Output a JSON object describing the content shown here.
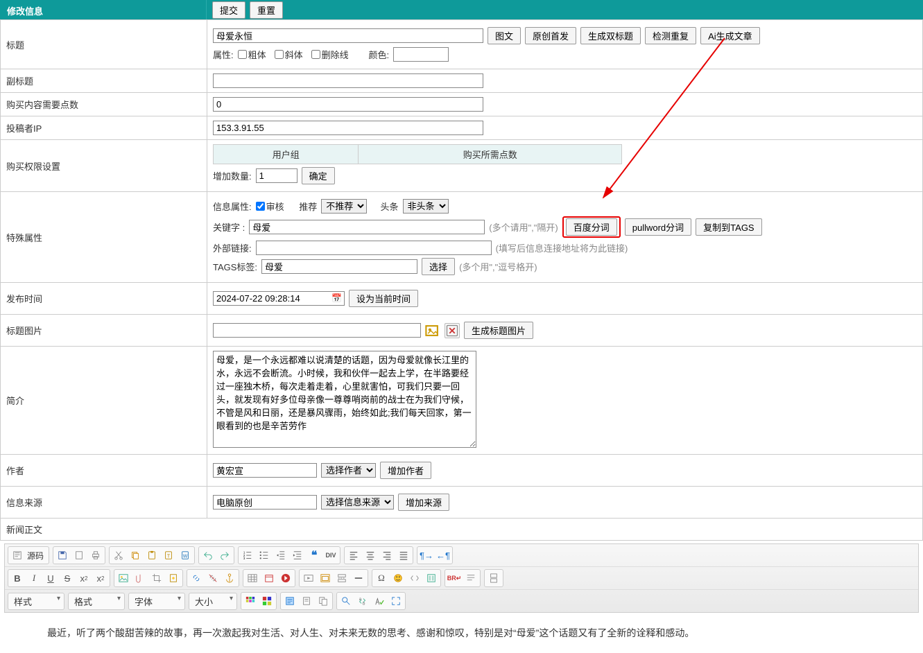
{
  "header": {
    "title": "修改信息",
    "submit": "提交",
    "reset": "重置"
  },
  "title_row": {
    "label": "标题",
    "value": "母爱永恒",
    "btn_media": "图文",
    "btn_original": "原创首发",
    "btn_dualtitle": "生成双标题",
    "btn_dup": "检测重复",
    "btn_ai": "Ai生成文章",
    "attr_label": "属性:",
    "chk_bold": "粗体",
    "chk_italic": "斜体",
    "chk_strike": "删除线",
    "color_label": "颜色:"
  },
  "subtitle": {
    "label": "副标题",
    "value": ""
  },
  "points": {
    "label": "购买内容需要点数",
    "value": "0"
  },
  "ip": {
    "label": "投稿者IP",
    "value": "153.3.91.55"
  },
  "perm": {
    "label": "购买权限设置",
    "col1": "用户组",
    "col2": "购买所需点数",
    "add_label": "增加数量:",
    "add_value": "1",
    "confirm": "确定"
  },
  "special": {
    "label": "特殊属性",
    "info_attr": "信息属性:",
    "audit": "审核",
    "recommend_label": "推荐",
    "recommend_value": "不推荐",
    "headline_label": "头条",
    "headline_value": "非头条",
    "kw_label": "关键字   :",
    "kw_value": "母爱",
    "kw_hint": "(多个请用\",\"隔开)",
    "btn_baidu": "百度分词",
    "btn_pullword": "pullword分词",
    "btn_copytags": "复制到TAGS",
    "ext_label": "外部链接:",
    "ext_value": "",
    "ext_hint": "(填写后信息连接地址将为此链接)",
    "tags_label": "TAGS标签:",
    "tags_value": "母爱",
    "tags_btn": "选择",
    "tags_hint": "(多个用\",\"逗号格开)"
  },
  "pubtime": {
    "label": "发布时间",
    "value": "2024-07-22 09:28:14",
    "btn_now": "设为当前时间"
  },
  "titlepic": {
    "label": "标题图片",
    "value": "",
    "btn_gen": "生成标题图片"
  },
  "intro": {
    "label": "简介",
    "value": "母爱，是一个永远都难以说清楚的话题，因为母爱就像长江里的水，永远不会断流。小时候，我和伙伴一起去上学，在半路要经过一座独木桥，每次走着走着，心里就害怕，可我们只要一回头，就发现有好多位母亲像一尊尊哨岗前的战士在为我们守候，不管是风和日丽，还是暴风骤雨，始终如此;我们每天回家，第一眼看到的也是辛苦劳作"
  },
  "author": {
    "label": "作者",
    "value": "黄宏宣",
    "select": "选择作者",
    "btn_add": "增加作者"
  },
  "source": {
    "label": "信息来源",
    "value": "电脑原创",
    "select": "选择信息来源",
    "btn_add": "增加来源"
  },
  "body": {
    "label": "新闻正文"
  },
  "editor": {
    "source_label": "源码",
    "style": "样式",
    "format": "格式",
    "font": "字体",
    "size": "大小"
  },
  "content": "　　最近，听了两个酸甜苦辣的故事，再一次激起我对生活、对人生、对未来无数的思考、感谢和惊叹，特别是对“母爱”这个话题又有了全新的诠释和感动。"
}
